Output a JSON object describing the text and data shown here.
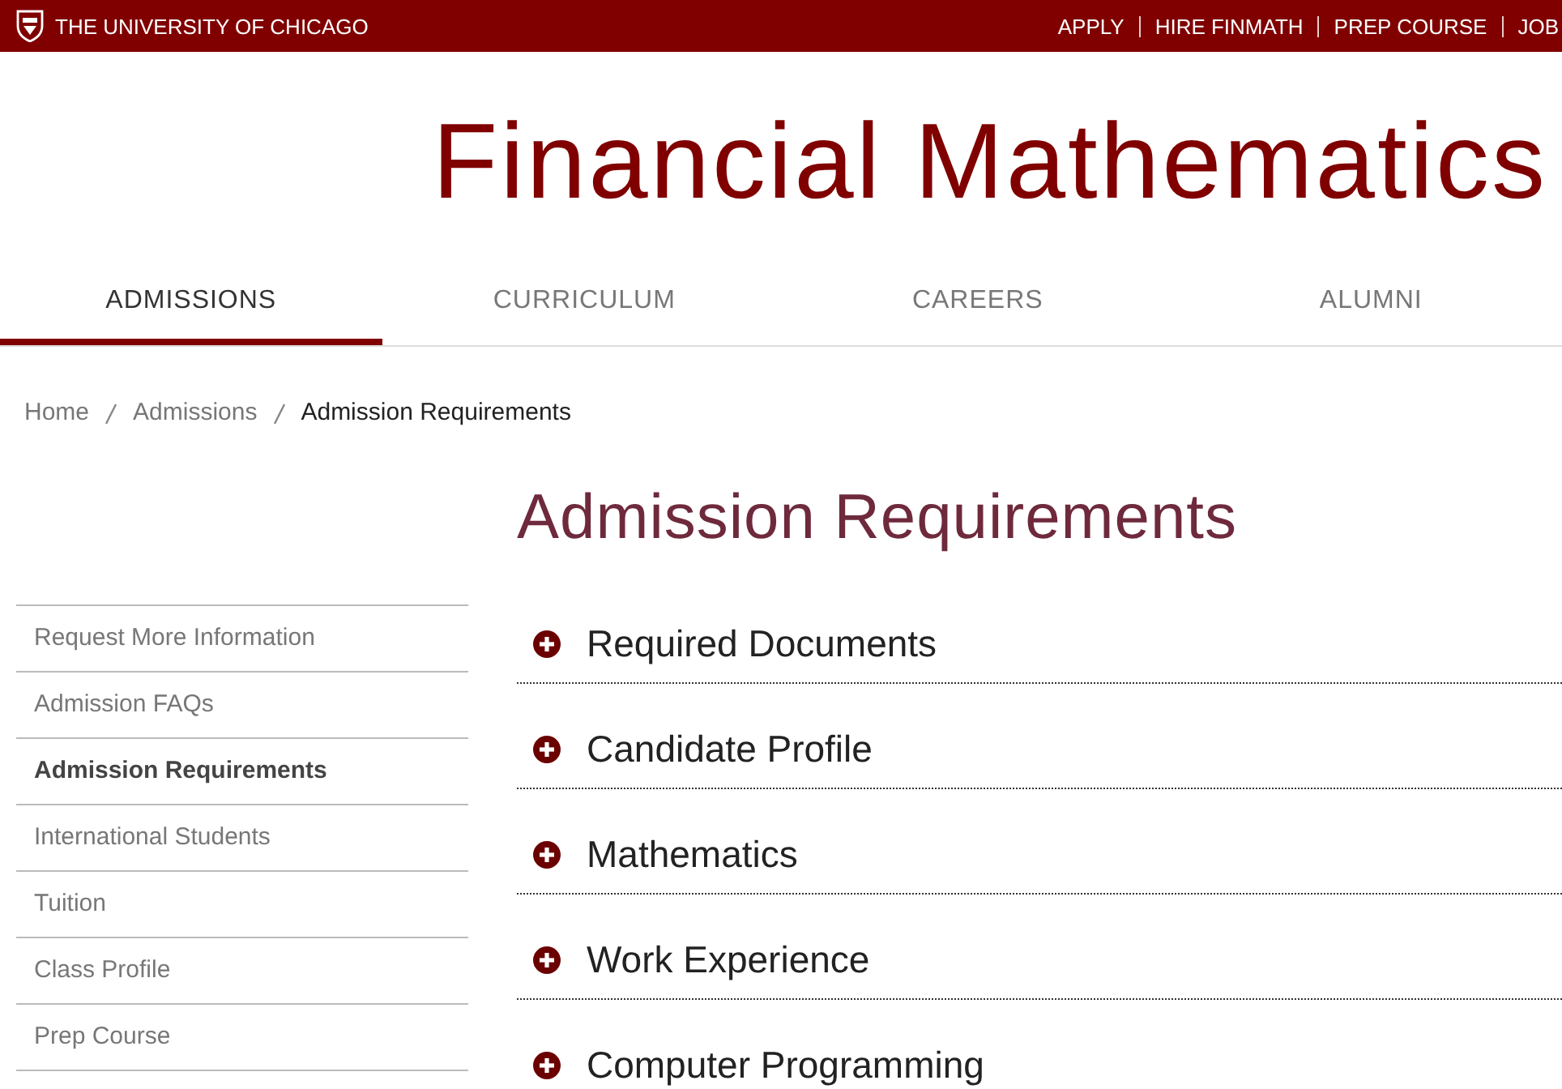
{
  "top_bar": {
    "university": "THE UNIVERSITY OF CHICAGO",
    "links": [
      "APPLY",
      "HIRE FINMATH",
      "PREP COURSE",
      "JOB"
    ]
  },
  "site_title": "Financial Mathematics",
  "tabs": [
    {
      "label": "ADMISSIONS",
      "selected": true
    },
    {
      "label": "CURRICULUM",
      "selected": false
    },
    {
      "label": "CAREERS",
      "selected": false
    },
    {
      "label": "ALUMNI",
      "selected": false
    }
  ],
  "breadcrumb": [
    {
      "label": "Home",
      "current": false
    },
    {
      "label": "Admissions",
      "current": false
    },
    {
      "label": "Admission Requirements",
      "current": true
    }
  ],
  "page_title": "Admission Requirements",
  "sidebar": {
    "items": [
      {
        "label": "Request More Information",
        "selected": false
      },
      {
        "label": "Admission FAQs",
        "selected": false
      },
      {
        "label": "Admission Requirements",
        "selected": true
      },
      {
        "label": "International Students",
        "selected": false
      },
      {
        "label": "Tuition",
        "selected": false
      },
      {
        "label": "Class Profile",
        "selected": false
      },
      {
        "label": "Prep Course",
        "selected": false
      }
    ]
  },
  "accordion": [
    {
      "title": "Required Documents",
      "expanded": false
    },
    {
      "title": "Candidate Profile",
      "expanded": false
    },
    {
      "title": "Mathematics",
      "expanded": false
    },
    {
      "title": "Work Experience",
      "expanded": false
    },
    {
      "title": "Computer Programming",
      "expanded": false
    }
  ]
}
